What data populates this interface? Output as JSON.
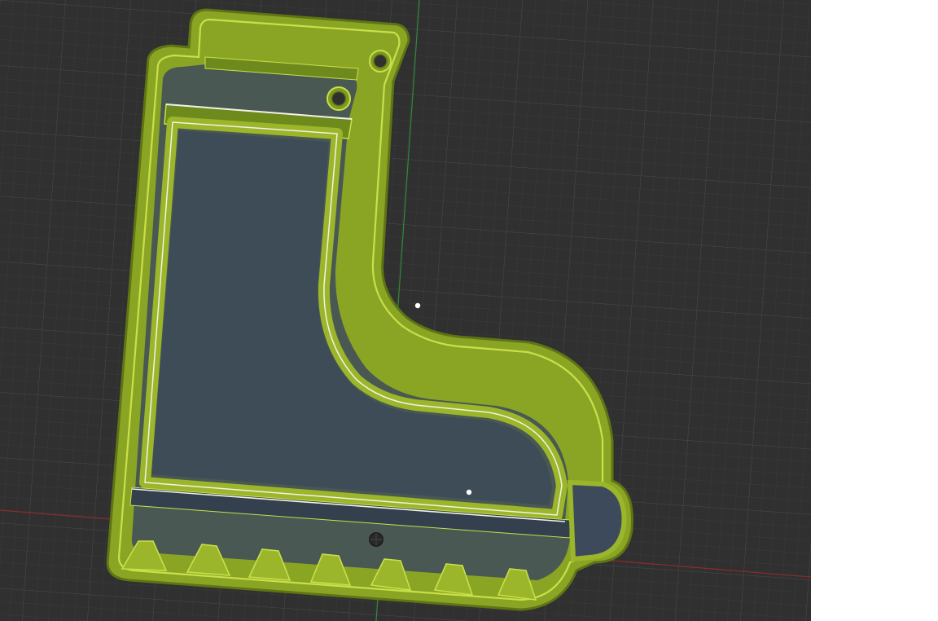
{
  "viewport": {
    "background": "#303030",
    "grid_minor_color": "#3a3a3a",
    "grid_major_color": "#474747",
    "x_axis_color": "#8a2c2c",
    "y_axis_color": "#2f8a3a",
    "grid_visible": true
  },
  "model": {
    "name": "boot-shaped-cutter",
    "body_color": "#9bb62a",
    "body_dark": "#5f7414",
    "body_light": "#c8e04a",
    "inner_fill": "#3d4a5c",
    "edge_highlight": "#f2f2e6",
    "hanging_holes": 2,
    "sole_teeth": 7
  },
  "markers": {
    "point_color": "#ffffff",
    "origin_icon": "origin-icon"
  },
  "side_panel": {
    "background": "#ffffff"
  }
}
